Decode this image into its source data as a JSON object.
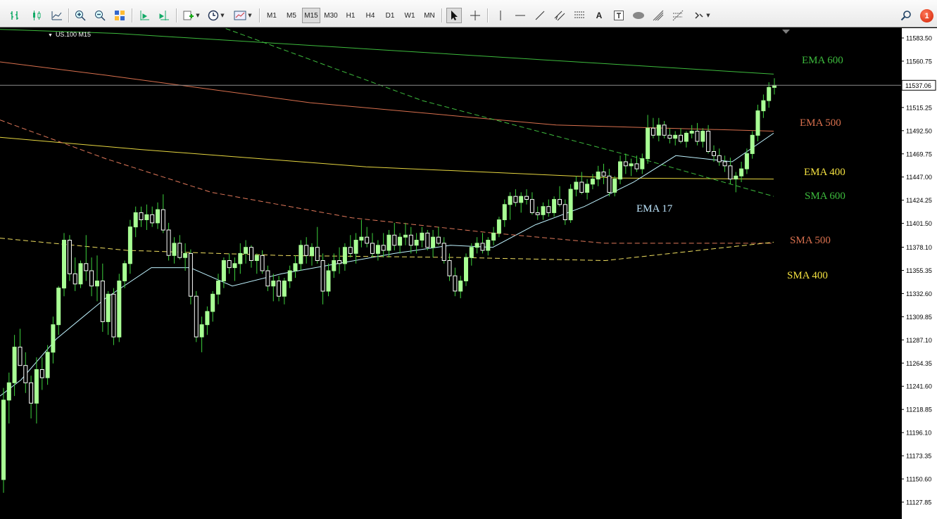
{
  "toolbar": {
    "timeframes": [
      "M1",
      "M5",
      "M15",
      "M30",
      "H1",
      "H4",
      "D1",
      "W1",
      "MN"
    ],
    "active_timeframe": "M15",
    "notification_count": "1"
  },
  "chart": {
    "symbol": "US.100 M15",
    "current_price_label": "11537.06",
    "background": "#000000",
    "bull_color": "#a8ff94",
    "bear_color": "#ffffff",
    "wick_color": "#3cd03c"
  },
  "indicator_labels": {
    "ema600": "EMA 600",
    "ema500": "EMA 500",
    "ema400": "EMA 400",
    "sma600": "SMA 600",
    "ema17": "EMA 17",
    "sma500": "SMA 500",
    "sma400": "SMA 400"
  },
  "chart_data": {
    "type": "candlestick",
    "price_axis_ticks": [
      "11583.50",
      "11560.75",
      "11538.00",
      "11515.25",
      "11492.50",
      "11469.75",
      "11447.00",
      "11424.25",
      "11401.50",
      "11378.10",
      "11355.35",
      "11332.60",
      "11309.85",
      "11287.10",
      "11264.35",
      "11241.60",
      "11218.85",
      "11196.10",
      "11173.35",
      "11150.60",
      "11127.85"
    ],
    "ylim": [
      11120,
      11590
    ],
    "current_price": 11537.06,
    "grid": false,
    "candles_ohlc": [
      [
        11150,
        11240,
        11137,
        11228
      ],
      [
        11228,
        11255,
        11205,
        11245
      ],
      [
        11245,
        11292,
        11232,
        11280
      ],
      [
        11280,
        11298,
        11265,
        11262
      ],
      [
        11262,
        11275,
        11235,
        11245
      ],
      [
        11245,
        11252,
        11210,
        11225
      ],
      [
        11225,
        11270,
        11205,
        11258
      ],
      [
        11258,
        11270,
        11238,
        11250
      ],
      [
        11250,
        11282,
        11243,
        11275
      ],
      [
        11275,
        11310,
        11264,
        11302
      ],
      [
        11302,
        11340,
        11292,
        11338
      ],
      [
        11338,
        11392,
        11330,
        11385
      ],
      [
        11385,
        11390,
        11345,
        11352
      ],
      [
        11352,
        11368,
        11335,
        11342
      ],
      [
        11342,
        11365,
        11338,
        11362
      ],
      [
        11362,
        11390,
        11345,
        11355
      ],
      [
        11355,
        11368,
        11330,
        11340
      ],
      [
        11340,
        11370,
        11325,
        11345
      ],
      [
        11345,
        11362,
        11295,
        11305
      ],
      [
        11305,
        11335,
        11292,
        11332
      ],
      [
        11332,
        11338,
        11282,
        11290
      ],
      [
        11290,
        11352,
        11285,
        11345
      ],
      [
        11345,
        11365,
        11338,
        11362
      ],
      [
        11362,
        11405,
        11352,
        11398
      ],
      [
        11398,
        11418,
        11388,
        11412
      ],
      [
        11412,
        11418,
        11398,
        11405
      ],
      [
        11405,
        11420,
        11395,
        11410
      ],
      [
        11410,
        11418,
        11398,
        11402
      ],
      [
        11402,
        11422,
        11396,
        11415
      ],
      [
        11415,
        11430,
        11392,
        11395
      ],
      [
        11395,
        11402,
        11365,
        11370
      ],
      [
        11370,
        11388,
        11362,
        11382
      ],
      [
        11382,
        11390,
        11366,
        11368
      ],
      [
        11368,
        11382,
        11355,
        11372
      ],
      [
        11372,
        11376,
        11322,
        11330
      ],
      [
        11330,
        11335,
        11285,
        11290
      ],
      [
        11290,
        11310,
        11275,
        11302
      ],
      [
        11302,
        11320,
        11292,
        11315
      ],
      [
        11315,
        11335,
        11305,
        11332
      ],
      [
        11332,
        11352,
        11322,
        11345
      ],
      [
        11345,
        11368,
        11338,
        11365
      ],
      [
        11365,
        11372,
        11352,
        11358
      ],
      [
        11358,
        11368,
        11345,
        11362
      ],
      [
        11362,
        11382,
        11352,
        11372
      ],
      [
        11372,
        11385,
        11362,
        11378
      ],
      [
        11378,
        11380,
        11358,
        11365
      ],
      [
        11365,
        11372,
        11352,
        11370
      ],
      [
        11370,
        11375,
        11352,
        11355
      ],
      [
        11355,
        11360,
        11335,
        11340
      ],
      [
        11340,
        11352,
        11325,
        11345
      ],
      [
        11345,
        11350,
        11325,
        11330
      ],
      [
        11330,
        11348,
        11322,
        11345
      ],
      [
        11345,
        11360,
        11338,
        11355
      ],
      [
        11355,
        11370,
        11348,
        11362
      ],
      [
        11362,
        11385,
        11355,
        11380
      ],
      [
        11380,
        11388,
        11362,
        11370
      ],
      [
        11370,
        11382,
        11360,
        11378
      ],
      [
        11378,
        11398,
        11362,
        11365
      ],
      [
        11365,
        11372,
        11322,
        11335
      ],
      [
        11335,
        11362,
        11330,
        11355
      ],
      [
        11355,
        11372,
        11348,
        11365
      ],
      [
        11365,
        11378,
        11352,
        11362
      ],
      [
        11362,
        11382,
        11355,
        11378
      ],
      [
        11378,
        11390,
        11368,
        11372
      ],
      [
        11372,
        11392,
        11362,
        11385
      ],
      [
        11385,
        11405,
        11378,
        11388
      ],
      [
        11388,
        11398,
        11378,
        11382
      ],
      [
        11382,
        11392,
        11368,
        11372
      ],
      [
        11372,
        11385,
        11365,
        11380
      ],
      [
        11380,
        11392,
        11368,
        11375
      ],
      [
        11375,
        11395,
        11368,
        11390
      ],
      [
        11390,
        11402,
        11375,
        11380
      ],
      [
        11380,
        11392,
        11372,
        11388
      ],
      [
        11388,
        11402,
        11380,
        11390
      ],
      [
        11390,
        11398,
        11372,
        11380
      ],
      [
        11380,
        11392,
        11372,
        11385
      ],
      [
        11385,
        11398,
        11378,
        11392
      ],
      [
        11392,
        11395,
        11375,
        11378
      ],
      [
        11378,
        11395,
        11368,
        11388
      ],
      [
        11388,
        11398,
        11380,
        11382
      ],
      [
        11382,
        11388,
        11362,
        11365
      ],
      [
        11365,
        11372,
        11345,
        11350
      ],
      [
        11350,
        11358,
        11330,
        11335
      ],
      [
        11335,
        11350,
        11328,
        11345
      ],
      [
        11345,
        11372,
        11340,
        11368
      ],
      [
        11368,
        11382,
        11360,
        11378
      ],
      [
        11378,
        11388,
        11372,
        11382
      ],
      [
        11382,
        11392,
        11372,
        11375
      ],
      [
        11375,
        11388,
        11370,
        11385
      ],
      [
        11385,
        11398,
        11380,
        11392
      ],
      [
        11392,
        11408,
        11388,
        11405
      ],
      [
        11405,
        11425,
        11398,
        11420
      ],
      [
        11420,
        11432,
        11405,
        11428
      ],
      [
        11428,
        11435,
        11418,
        11422
      ],
      [
        11422,
        11432,
        11412,
        11428
      ],
      [
        11428,
        11435,
        11420,
        11425
      ],
      [
        11425,
        11432,
        11410,
        11412
      ],
      [
        11412,
        11418,
        11405,
        11410
      ],
      [
        11410,
        11422,
        11405,
        11418
      ],
      [
        11418,
        11425,
        11408,
        11412
      ],
      [
        11412,
        11428,
        11408,
        11425
      ],
      [
        11425,
        11438,
        11418,
        11420
      ],
      [
        11420,
        11425,
        11400,
        11405
      ],
      [
        11405,
        11440,
        11402,
        11435
      ],
      [
        11435,
        11448,
        11428,
        11442
      ],
      [
        11442,
        11452,
        11430,
        11432
      ],
      [
        11432,
        11445,
        11425,
        11440
      ],
      [
        11440,
        11450,
        11435,
        11445
      ],
      [
        11445,
        11458,
        11438,
        11452
      ],
      [
        11452,
        11460,
        11440,
        11448
      ],
      [
        11448,
        11455,
        11428,
        11432
      ],
      [
        11432,
        11448,
        11428,
        11445
      ],
      [
        11445,
        11468,
        11440,
        11462
      ],
      [
        11462,
        11470,
        11450,
        11458
      ],
      [
        11458,
        11465,
        11448,
        11460
      ],
      [
        11460,
        11468,
        11452,
        11455
      ],
      [
        11455,
        11470,
        11450,
        11465
      ],
      [
        11465,
        11508,
        11460,
        11495
      ],
      [
        11495,
        11505,
        11485,
        11488
      ],
      [
        11488,
        11505,
        11482,
        11498
      ],
      [
        11498,
        11502,
        11485,
        11488
      ],
      [
        11488,
        11495,
        11480,
        11485
      ],
      [
        11485,
        11492,
        11478,
        11488
      ],
      [
        11488,
        11495,
        11480,
        11482
      ],
      [
        11482,
        11492,
        11476,
        11490
      ],
      [
        11490,
        11498,
        11485,
        11492
      ],
      [
        11492,
        11500,
        11478,
        11482
      ],
      [
        11482,
        11495,
        11476,
        11492
      ],
      [
        11492,
        11498,
        11470,
        11472
      ],
      [
        11472,
        11478,
        11462,
        11468
      ],
      [
        11468,
        11475,
        11458,
        11462
      ],
      [
        11462,
        11468,
        11452,
        11458
      ],
      [
        11458,
        11466,
        11440,
        11445
      ],
      [
        11445,
        11452,
        11432,
        11448
      ],
      [
        11448,
        11462,
        11442,
        11455
      ],
      [
        11455,
        11475,
        11450,
        11470
      ],
      [
        11470,
        11492,
        11465,
        11488
      ],
      [
        11488,
        11518,
        11482,
        11512
      ],
      [
        11512,
        11528,
        11505,
        11522
      ],
      [
        11522,
        11540,
        11515,
        11535
      ],
      [
        11535,
        11544,
        11528,
        11537
      ]
    ],
    "series": [
      {
        "name": "EMA 600",
        "color": "#3dbb3d",
        "style": "solid",
        "x": [
          0,
          165,
          540,
          890,
          1099
        ],
        "y": [
          11592,
          11588,
          11572,
          11557,
          11548
        ]
      },
      {
        "name": "EMA 500",
        "color": "#d9704e",
        "style": "solid",
        "x": [
          0,
          150,
          440,
          790,
          1099
        ],
        "y": [
          11560,
          11547,
          11520,
          11498,
          11492
        ]
      },
      {
        "name": "EMA 400",
        "color": "#e6d640",
        "style": "solid",
        "x": [
          0,
          200,
          520,
          880,
          1099
        ],
        "y": [
          11486,
          11474,
          11457,
          11446,
          11445
        ]
      },
      {
        "name": "SMA 600",
        "color": "#3dbb3d",
        "style": "dashed",
        "x": [
          300,
          600,
          900,
          1099
        ],
        "y": [
          11598,
          11522,
          11467,
          11428
        ]
      },
      {
        "name": "EMA 17",
        "color": "#bff3ff",
        "style": "solid",
        "x": [
          0,
          30,
          80,
          150,
          215,
          270,
          330,
          400,
          480,
          560,
          640,
          700,
          760,
          830,
          900,
          960,
          1040,
          1099
        ],
        "y": [
          11232,
          11248,
          11288,
          11328,
          11358,
          11358,
          11340,
          11352,
          11362,
          11372,
          11380,
          11378,
          11400,
          11418,
          11442,
          11468,
          11462,
          11490
        ]
      },
      {
        "name": "SMA 500",
        "color": "#e0785a",
        "style": "dashed",
        "x": [
          0,
          150,
          300,
          500,
          700,
          860,
          1099
        ],
        "y": [
          11503,
          11465,
          11432,
          11407,
          11392,
          11382,
          11382
        ]
      },
      {
        "name": "SMA 400",
        "color": "#f0df60",
        "style": "dashed",
        "x": [
          0,
          180,
          400,
          650,
          860,
          1099
        ],
        "y": [
          11387,
          11375,
          11370,
          11368,
          11365,
          11383
        ]
      }
    ]
  }
}
